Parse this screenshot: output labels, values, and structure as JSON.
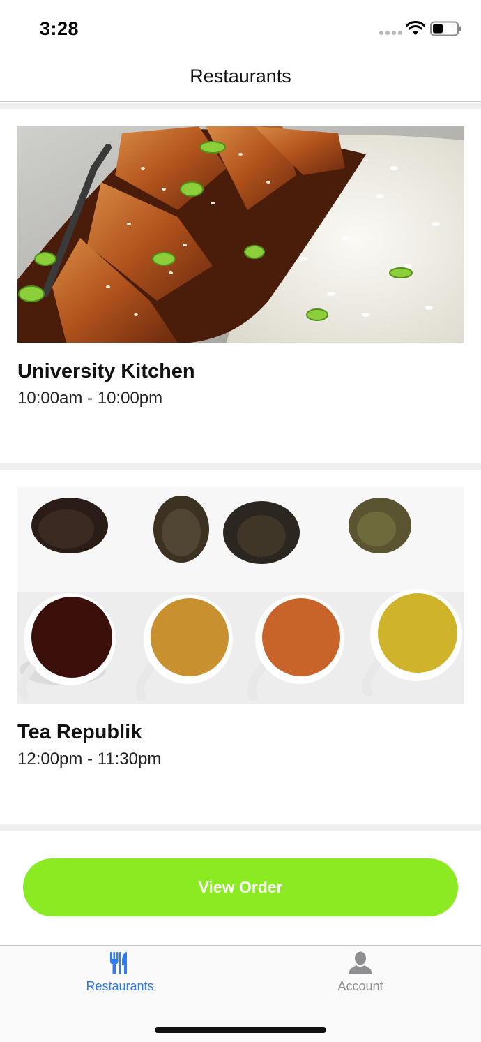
{
  "status_bar": {
    "time": "3:28",
    "wifi_icon": "wifi-icon",
    "battery_icon": "battery-icon"
  },
  "nav": {
    "title": "Restaurants"
  },
  "restaurants": [
    {
      "name": "University Kitchen",
      "hours": "10:00am - 10:00pm",
      "image": "teriyaki-chicken-rice-photo"
    },
    {
      "name": "Tea Republik",
      "hours": "12:00pm - 11:30pm",
      "image": "tea-leaves-cups-photo"
    }
  ],
  "order": {
    "button_label": "View Order",
    "button_color": "#8aeb23"
  },
  "tab_bar": {
    "tabs": [
      {
        "label": "Restaurants",
        "icon": "fork-knife-icon",
        "active": true,
        "color": "#2f7cf6"
      },
      {
        "label": "Account",
        "icon": "user-icon",
        "active": false,
        "color": "#8e8e93"
      }
    ]
  }
}
